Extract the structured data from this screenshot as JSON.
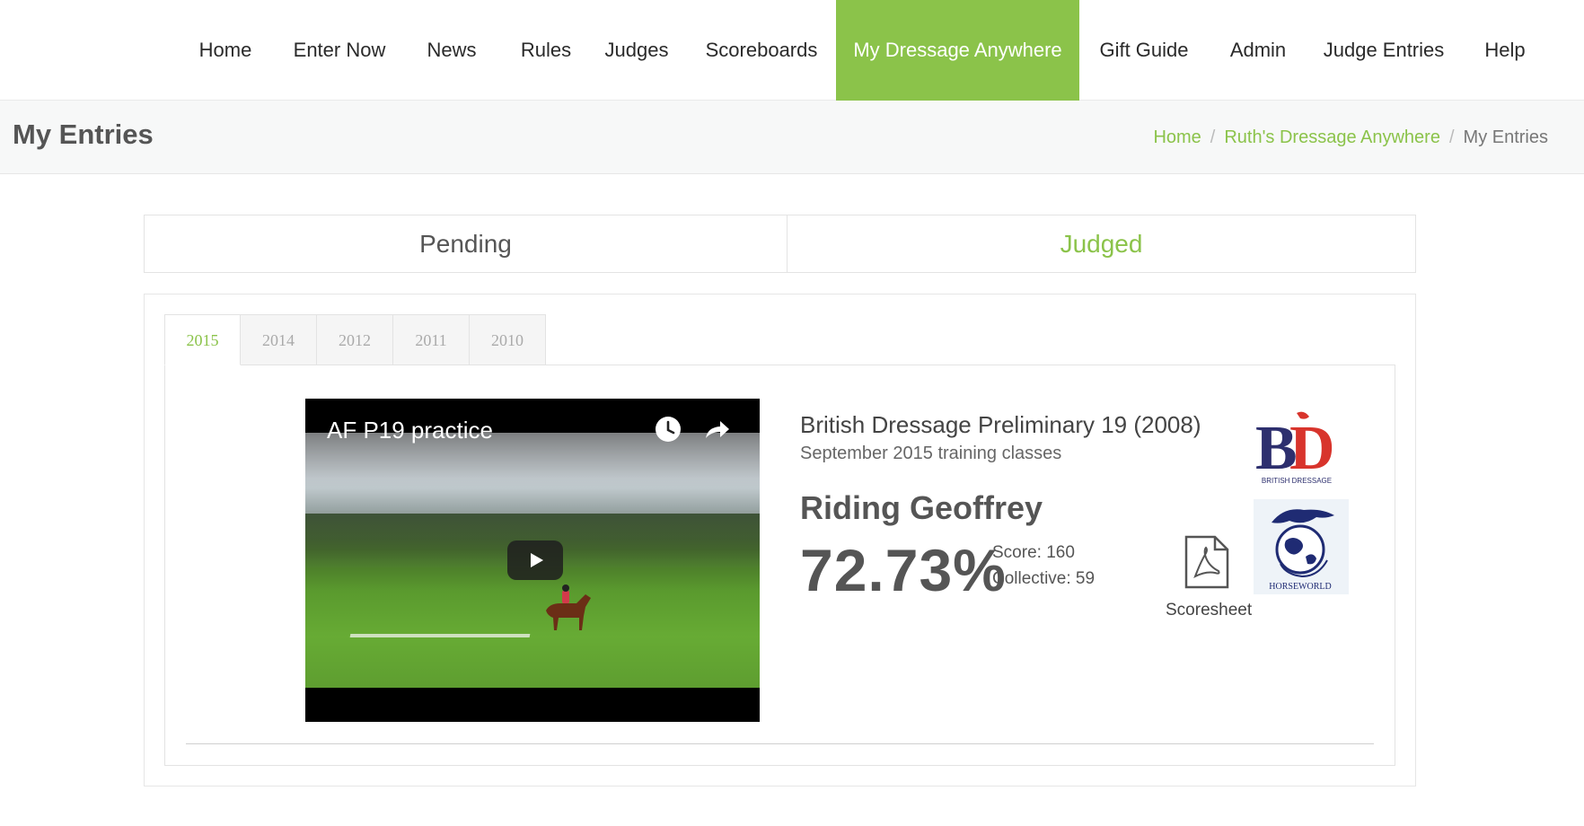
{
  "nav": {
    "items": [
      {
        "label": "Home"
      },
      {
        "label": "Enter Now"
      },
      {
        "label": "News"
      },
      {
        "label": "Rules"
      },
      {
        "label": "Judges"
      },
      {
        "label": "Scoreboards"
      },
      {
        "label": "My Dressage Anywhere",
        "active": true
      },
      {
        "label": "Gift Guide"
      },
      {
        "label": "Admin"
      },
      {
        "label": "Judge Entries"
      },
      {
        "label": "Help"
      }
    ]
  },
  "page": {
    "title": "My Entries",
    "breadcrumb": [
      "Home",
      "Ruth's Dressage Anywhere",
      "My Entries"
    ]
  },
  "tabs": {
    "pending": "Pending",
    "judged": "Judged",
    "active": "Judged"
  },
  "years": {
    "items": [
      "2015",
      "2014",
      "2012",
      "2011",
      "2010"
    ],
    "active": "2015"
  },
  "entry": {
    "video_title": "AF P19 practice",
    "test_name": "British Dressage Preliminary 19 (2008)",
    "class_name": "September 2015 training classes",
    "rider": "Riding Geoffrey",
    "percentage": "72.73%",
    "score": "Score: 160",
    "collective": "Collective: 59",
    "scoresheet_label": "Scoresheet",
    "logos": {
      "bd_text": "BRITISH DRESSAGE",
      "hw_text": "HORSEWORLD"
    }
  },
  "colors": {
    "accent": "#8bc34a",
    "bd_navy": "#2d2f6e",
    "bd_red": "#d8342c"
  }
}
